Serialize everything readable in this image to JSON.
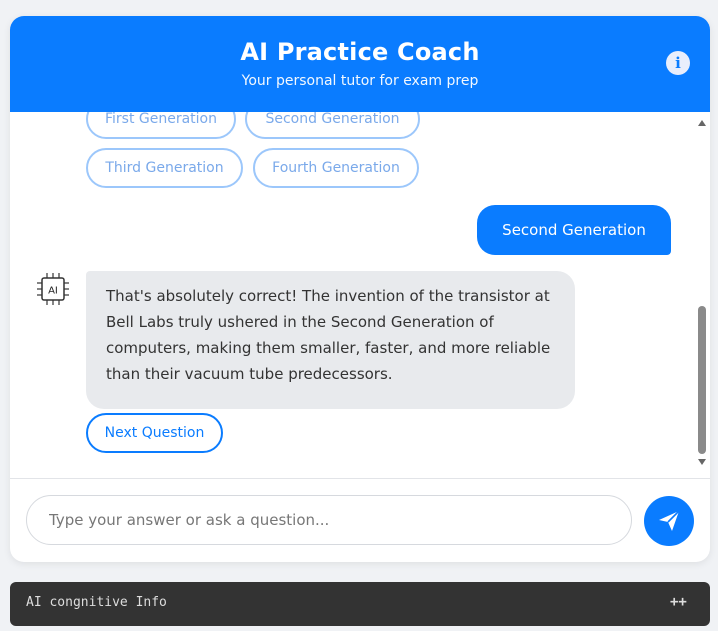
{
  "header": {
    "title": "AI Practice Coach",
    "subtitle": "Your personal tutor for exam prep",
    "info_icon": "i"
  },
  "chat": {
    "options": [
      "First Generation",
      "Second Generation",
      "Third Generation",
      "Fourth Generation"
    ],
    "user_message": "Second Generation",
    "bot_avatar_text": "AI",
    "bot_message": "That's absolutely correct! The invention of the transistor at Bell Labs truly ushered in the Second Generation of computers, making them smaller, faster, and more reliable than their vacuum tube predecessors.",
    "next_button": "Next Question"
  },
  "composer": {
    "placeholder": "Type your answer or ask a question...",
    "value": ""
  },
  "footer": {
    "label": "AI congnitive Info",
    "toggle": "++"
  },
  "colors": {
    "accent": "#0a7cff",
    "bot_bubble": "#e8eaed",
    "footer_bg": "#333333"
  },
  "icons": {
    "info": "info-icon",
    "avatar": "ai-chip-icon",
    "send": "paper-plane-icon"
  }
}
